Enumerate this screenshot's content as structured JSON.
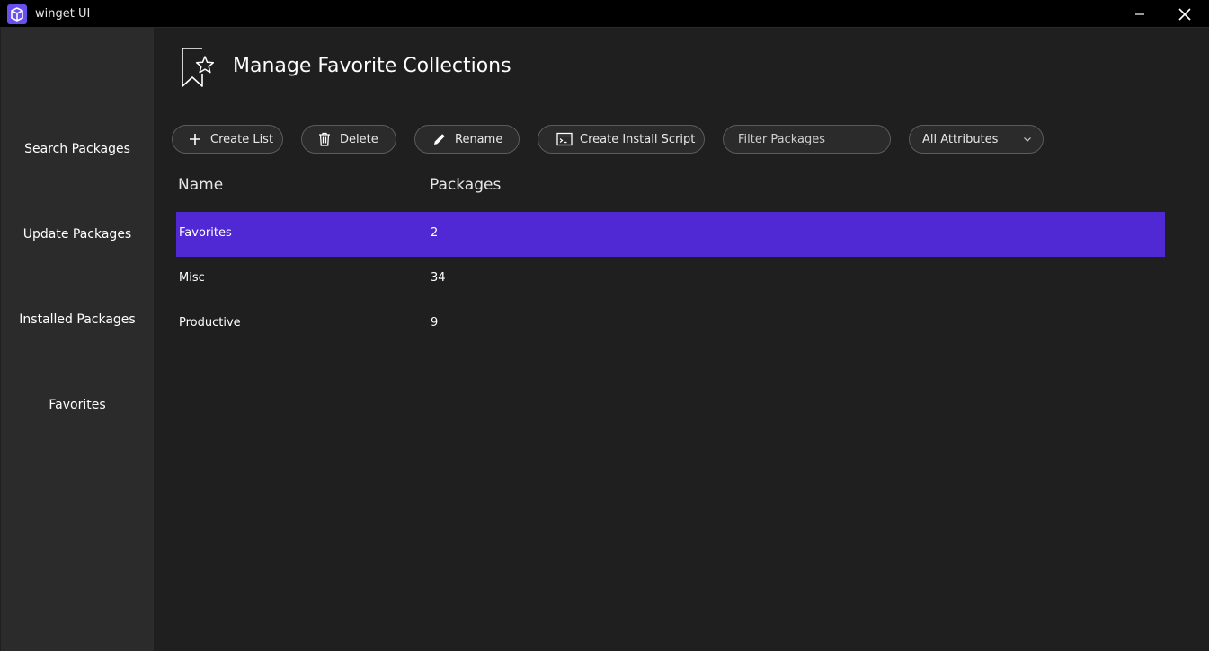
{
  "window": {
    "title": "winget UI",
    "minimize_icon": "minimize-icon",
    "close_icon": "close-icon"
  },
  "sidebar": {
    "items": [
      {
        "label": "Search Packages"
      },
      {
        "label": "Update Packages"
      },
      {
        "label": "Installed Packages"
      },
      {
        "label": "Favorites"
      }
    ]
  },
  "header": {
    "title": "Manage Favorite Collections",
    "icon": "bookmark-star-icon"
  },
  "toolbar": {
    "create_list": "Create List",
    "delete": "Delete",
    "rename": "Rename",
    "create_install_script": "Create Install Script",
    "filter_placeholder": "Filter Packages",
    "attribute_selected": "All Attributes"
  },
  "table": {
    "columns": [
      "Name",
      "Packages"
    ],
    "rows": [
      {
        "name": "Favorites",
        "packages": "2",
        "selected": true
      },
      {
        "name": "Misc",
        "packages": "34",
        "selected": false
      },
      {
        "name": "Productive",
        "packages": "9",
        "selected": false
      }
    ]
  },
  "colors": {
    "accent": "#5129d4",
    "background": "#1f1f1f",
    "sidebar": "#2b2b2b",
    "titlebar": "#000000"
  }
}
